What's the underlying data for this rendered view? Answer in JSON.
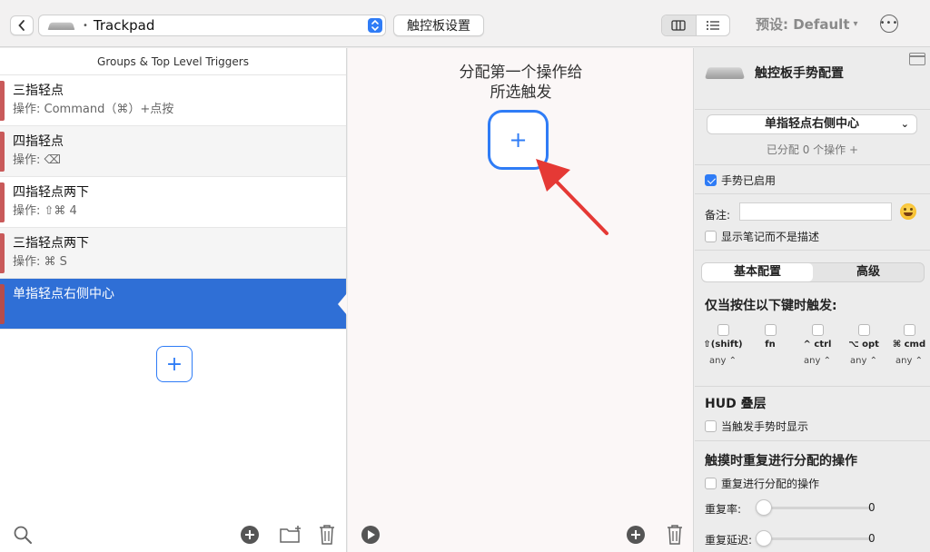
{
  "toolbar": {
    "device_label": "Trackpad",
    "device_dot": "•",
    "settings_label": "触控板设置",
    "preset_label": "预设: Default",
    "preset_caret": "▾",
    "more_label": "•••"
  },
  "left_panel": {
    "header": "Groups & Top Level Triggers",
    "triggers": [
      {
        "title": "三指轻点",
        "subtitle": "操作: Command（⌘）+点按"
      },
      {
        "title": "四指轻点",
        "subtitle": "操作: ⌫"
      },
      {
        "title": "四指轻点两下",
        "subtitle": "操作: ⇧⌘ 4"
      },
      {
        "title": "三指轻点两下",
        "subtitle": "操作: ⌘ S"
      },
      {
        "title": "单指轻点右侧中心",
        "subtitle": ""
      }
    ],
    "add_label": "+"
  },
  "middle_panel": {
    "title_line1": "分配第一个操作给",
    "title_line2": "所选触发",
    "add_label": "+"
  },
  "right_panel": {
    "title": "触控板手势配置",
    "gesture_select": "单指轻点右侧中心",
    "gesture_chevron": "⌄",
    "assigned_text": "已分配 0 个操作 +",
    "enabled_label": "手势已启用",
    "note_label": "备注:",
    "note_value": "",
    "show_note_label": "显示笔记而不是描述",
    "tabs": [
      {
        "label": "基本配置",
        "active": true
      },
      {
        "label": "高级",
        "active": false
      }
    ],
    "modifier_title": "仅当按住以下键时触发:",
    "modifiers": [
      {
        "name": "⇧(shift)",
        "value": "any ⌃"
      },
      {
        "name": "fn",
        "value": ""
      },
      {
        "name": "^ ctrl",
        "value": "any ⌃"
      },
      {
        "name": "⌥ opt",
        "value": "any ⌃"
      },
      {
        "name": "⌘ cmd",
        "value": "any ⌃"
      }
    ],
    "hud_title": "HUD 叠层",
    "hud_label": "当触发手势时显示",
    "repeat_title": "触摸时重复进行分配的操作",
    "repeat_label": "重复进行分配的操作",
    "repeat_rate_label": "重复率:",
    "repeat_rate_value": "0",
    "repeat_delay_label": "重复延迟:",
    "repeat_delay_value": "0"
  },
  "colors": {
    "accent": "#2f7cf6",
    "selection": "#2f6fd6",
    "trigger_bar": "#c95a5a",
    "arrow": "#e53935"
  }
}
